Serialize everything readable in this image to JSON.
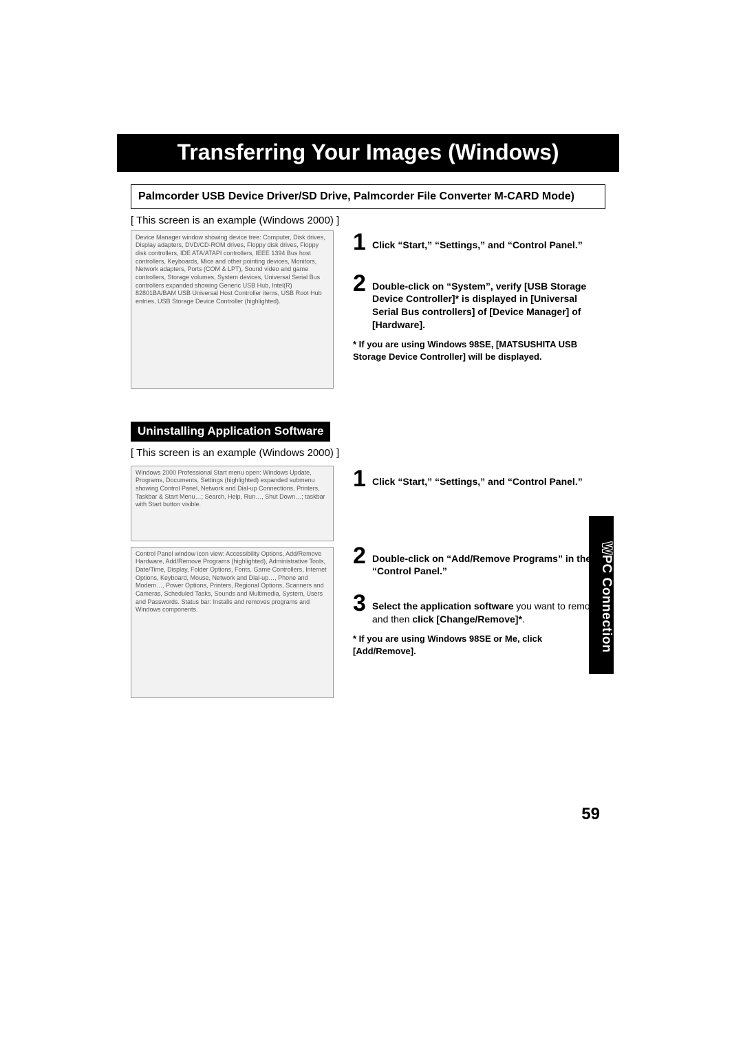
{
  "title": "Transferring Your Images (Windows)",
  "subtitle": "Palmcorder USB Device Driver/SD Drive, Palmcorder File Converter M-CARD Mode)",
  "caption1": "[ This screen is an example (Windows 2000) ]",
  "screenshot1_alt": "Device Manager window showing device tree: Computer, Disk drives, Display adapters, DVD/CD-ROM drives, Floppy disk drives, Floppy disk controllers, IDE ATA/ATAPI controllers, IEEE 1394 Bus host controllers, Keyboards, Mice and other pointing devices, Monitors, Network adapters, Ports (COM & LPT), Sound video and game controllers, Storage volumes, System devices, Universal Serial Bus controllers expanded showing Generic USB Hub, Intel(R) 82801BA/BAM USB Universal Host Controller items, USB Root Hub entries, USB Storage Device Controller (highlighted).",
  "sec1": {
    "step1": "Click “Start,” “Settings,” and “Control Panel.”",
    "step2": "Double-click on “System”, verify [USB Storage Device Controller]* is displayed in [Universal Serial Bus controllers] of [Device Manager] of [Hardware].",
    "note": "* If you are using Windows 98SE, [MATSUSHITA USB Storage Device Controller] will be displayed."
  },
  "section2_title": "Uninstalling Application Software",
  "caption2": "[ This screen is an example (Windows 2000) ]",
  "screenshot2_alt": "Windows 2000 Professional Start menu open: Windows Update, Programs, Documents, Settings (highlighted) expanded submenu showing Control Panel, Network and Dial-up Connections, Printers, Taskbar & Start Menu…; Search, Help, Run…, Shut Down…; taskbar with Start button visible.",
  "screenshot3_alt": "Control Panel window icon view: Accessibility Options, Add/Remove Hardware, Add/Remove Programs (highlighted), Administrative Tools, Date/Time, Display, Folder Options, Fonts, Game Controllers, Internet Options, Keyboard, Mouse, Network and Dial-up…, Phone and Modem…, Power Options, Printers, Regional Options, Scanners and Cameras, Scheduled Tasks, Sounds and Multimedia, System, Users and Passwords. Status bar: Installs and removes programs and Windows components.",
  "sec2": {
    "step1": "Click “Start,” “Settings,” and “Control Panel.”",
    "step2": "Double-click on “Add/Remove Programs” in the “Control Panel.”",
    "step3_lead": "Select the application software",
    "step3_mid": " you want to remove, and then ",
    "step3_tail": "click [Change/Remove]*",
    "step3_end": ".",
    "note": "* If you are using Windows 98SE or Me, click [Add/Remove]."
  },
  "side_tab_w": "W",
  "side_tab_rest": "PC Connection",
  "page_number": "59"
}
